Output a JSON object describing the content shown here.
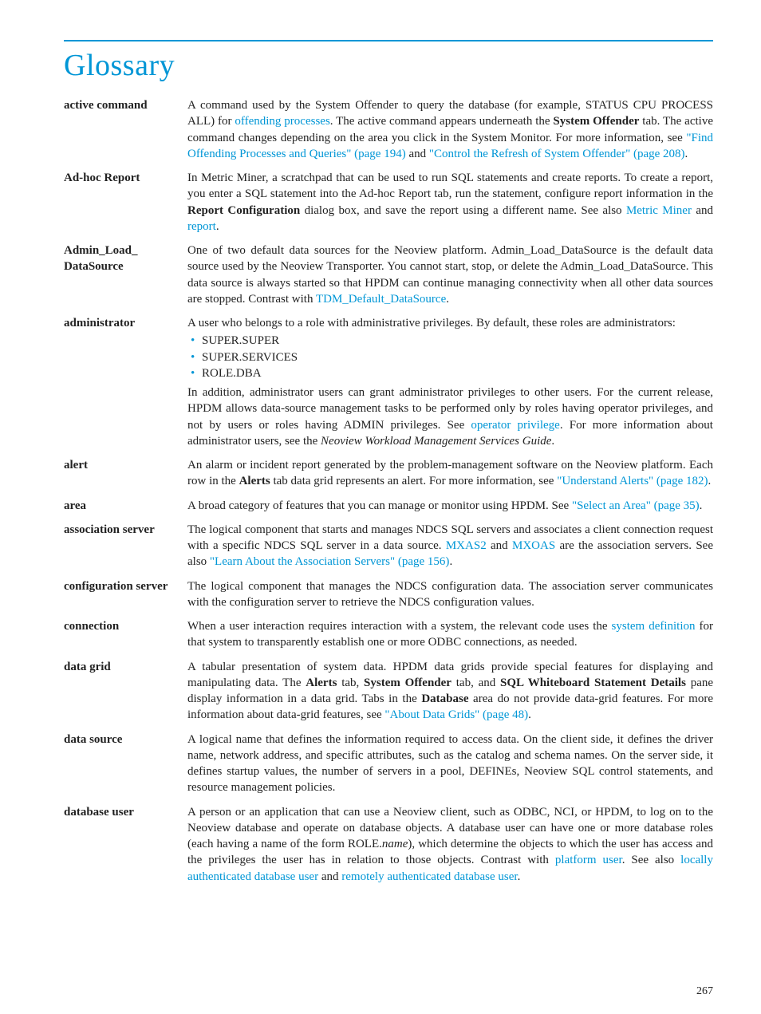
{
  "title": "Glossary",
  "pageNumber": "267",
  "entries": {
    "active_command": {
      "term": "active command",
      "p1a": "A command used by the System Offender to query the database (for example, STATUS CPU PROCESS ALL) for ",
      "link1": "offending processes",
      "p1b": ". The active command appears underneath the ",
      "bold1": "System Offender",
      "p1c": " tab. The active command changes depending on the area you click in the System Monitor. For more information, see ",
      "link2": "\"Find Offending Processes and Queries\" (page 194)",
      "p1d": " and ",
      "link3": "\"Control the Refresh of System Offender\" (page 208)",
      "p1e": "."
    },
    "adhoc": {
      "term": "Ad-hoc Report",
      "p1a": "In Metric Miner, a scratchpad that can be used to run SQL statements and create reports. To create a report, you enter a SQL statement into the Ad-hoc Report tab, run the statement, configure report information in the ",
      "bold1": "Report Configuration",
      "p1b": "  dialog box, and save the report using a different name. See also ",
      "link1": "Metric Miner",
      "p1c": " and ",
      "link2": "report",
      "p1d": "."
    },
    "admin_load": {
      "term": "Admin_Load_ DataSource",
      "p1a": "One of two default data sources for the Neoview platform. Admin_Load_DataSource is the default data source used by the Neoview Transporter. You cannot start, stop, or delete the Admin_Load_DataSource. This data source is always started so that HPDM can continue managing connectivity when all other data sources are stopped. Contrast with ",
      "link1": "TDM_Default_DataSource",
      "p1b": "."
    },
    "administrator": {
      "term": "administrator",
      "p1": "A user who belongs to a role with administrative privileges. By default, these roles are administrators:",
      "roles": [
        "SUPER.SUPER",
        "SUPER.SERVICES",
        "ROLE.DBA"
      ],
      "p2a": "In addition, administrator users can grant administrator privileges to other users. For the current release, HPDM allows data-source management tasks to be performed only by roles having operator privileges, and not by users or roles having ADMIN privileges. See ",
      "link1": "operator privilege",
      "p2b": ". For more information about administrator users, see the ",
      "ital1": "Neoview Workload Management Services Guide",
      "p2c": "."
    },
    "alert": {
      "term": "alert",
      "p1a": "An alarm or incident report generated by the problem-management software on the Neoview platform. Each row in the ",
      "bold1": "Alerts",
      "p1b": " tab data grid represents an alert. For more information, see ",
      "link1": "\"Understand Alerts\" (page 182)",
      "p1c": "."
    },
    "area": {
      "term": "area",
      "p1a": "A broad category of features that you can manage or monitor using HPDM. See ",
      "link1": "\"Select an Area\" (page 35)",
      "p1b": "."
    },
    "assoc": {
      "term": "association server",
      "p1a": "The logical component that starts and manages NDCS SQL servers and associates a client connection request with a specific NDCS SQL server in a data source. ",
      "link1": "MXAS2",
      "p1b": " and ",
      "link2": "MXOAS",
      "p1c": " are the association servers. See also ",
      "link3": "\"Learn About the Association Servers\" (page 156)",
      "p1d": "."
    },
    "config": {
      "term": "configuration server",
      "p1": "The logical component that manages the NDCS configuration data. The association server communicates with the configuration server to retrieve the NDCS configuration values."
    },
    "connection": {
      "term": "connection",
      "p1a": "When a user interaction requires interaction with a system, the relevant code uses the ",
      "link1": "system definition",
      "p1b": " for that system to transparently establish one or more ODBC connections, as needed."
    },
    "datagrid": {
      "term": "data grid",
      "p1a": "A tabular presentation of system data. HPDM data grids provide special features for displaying and manipulating data. The ",
      "bold1": "Alerts",
      "p1b": " tab, ",
      "bold2": "System Offender",
      "p1c": " tab, and ",
      "bold3": "SQL Whiteboard Statement Details",
      "p1d": " pane display information in a data grid. Tabs in the ",
      "bold4": "Database",
      "p1e": " area do not provide data-grid features. For more information about data-grid features, see ",
      "link1": "\"About Data Grids\" (page 48)",
      "p1f": "."
    },
    "datasource": {
      "term": "data source",
      "p1": "A logical name that defines the information required to access data. On the client side, it defines the driver name, network address, and specific attributes, such as the catalog and schema names. On the server side, it defines startup values, the number of servers in a pool, DEFINEs, Neoview SQL control statements, and resource management policies."
    },
    "dbuser": {
      "term": "database user",
      "p1a": "A person or an application that can use a Neoview client, such as ODBC, NCI, or HPDM, to log on to the Neoview database and operate on database objects. A database user can have one or more database roles (each having a name of the form ROLE.",
      "ital1": "name",
      "p1b": "), which determine the objects to which the user has access and the privileges the user has in relation to those objects. Contrast with ",
      "link1": "platform user",
      "p1c": ". See also ",
      "link2": "locally authenticated database user",
      "p1d": " and ",
      "link3": "remotely authenticated database user",
      "p1e": "."
    }
  }
}
